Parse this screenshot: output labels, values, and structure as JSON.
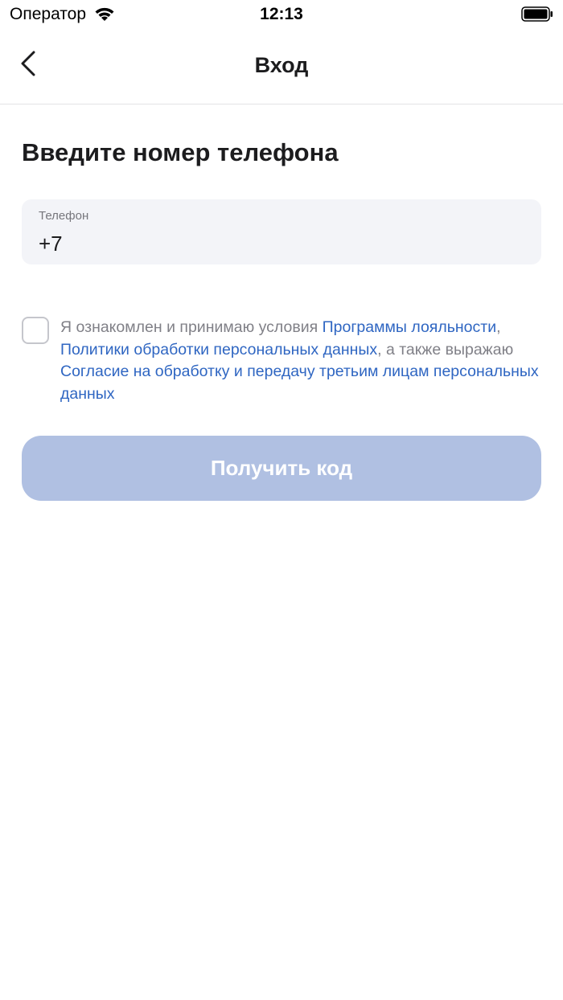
{
  "status_bar": {
    "carrier": "Оператор",
    "time": "12:13"
  },
  "nav": {
    "title": "Вход",
    "back_icon": "chevron-left-icon"
  },
  "form": {
    "heading": "Введите номер телефона",
    "phone": {
      "label": "Телефон",
      "value": "+7"
    },
    "consent": {
      "checked": false,
      "text_1": "Я ознакомлен и принимаю условия ",
      "link_loyalty": "Программы лояльности",
      "sep_1": ", ",
      "link_privacy": "Политики обработки персональных данных",
      "text_2": ", а также выражаю ",
      "link_consent": "Согласие на обработку и передачу третьим лицам персональных данных"
    },
    "submit_label": "Получить код",
    "submit_enabled": false
  },
  "colors": {
    "link": "#2f66c2",
    "button_disabled": "#b0c0e2",
    "field_bg": "#f3f4f8"
  }
}
